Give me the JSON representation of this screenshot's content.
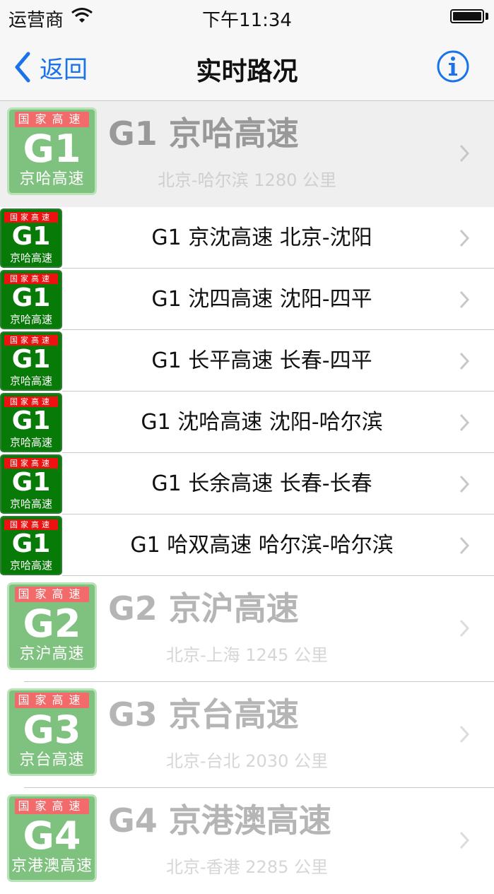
{
  "status_bar": {
    "carrier": "运营商",
    "time": "下午11:34"
  },
  "nav": {
    "back_label": "返回",
    "title": "实时路况"
  },
  "badge_top": "国家高速",
  "groups": [
    {
      "code": "G1",
      "badge_name": "京哈高速",
      "title": "G1 京哈高速",
      "subtitle": "北京-哈尔滨  1280 公里",
      "expanded": true,
      "rows": [
        {
          "code": "G1",
          "badge_name": "京哈高速",
          "text": "G1 京沈高速  北京-沈阳"
        },
        {
          "code": "G1",
          "badge_name": "京哈高速",
          "text": "G1 沈四高速  沈阳-四平"
        },
        {
          "code": "G1",
          "badge_name": "京哈高速",
          "text": "G1 长平高速  长春-四平"
        },
        {
          "code": "G1",
          "badge_name": "京哈高速",
          "text": "G1 沈哈高速  沈阳-哈尔滨"
        },
        {
          "code": "G1",
          "badge_name": "京哈高速",
          "text": "G1 长余高速  长春-长春"
        },
        {
          "code": "G1",
          "badge_name": "京哈高速",
          "text": "G1 哈双高速  哈尔滨-哈尔滨"
        }
      ]
    },
    {
      "code": "G2",
      "badge_name": "京沪高速",
      "title": "G2 京沪高速",
      "subtitle": "北京-上海  1245 公里",
      "expanded": false
    },
    {
      "code": "G3",
      "badge_name": "京台高速",
      "title": "G3 京台高速",
      "subtitle": "北京-台北  2030 公里",
      "expanded": false
    },
    {
      "code": "G4",
      "badge_name": "京港澳高速",
      "title": "G4 京港澳高速",
      "subtitle": "北京-香港  2285 公里",
      "expanded": false
    }
  ],
  "colors": {
    "accent": "#1a73e8",
    "badge_green": "#087a08",
    "badge_red": "#e11111",
    "badge_light_green": "#7fc27f"
  }
}
